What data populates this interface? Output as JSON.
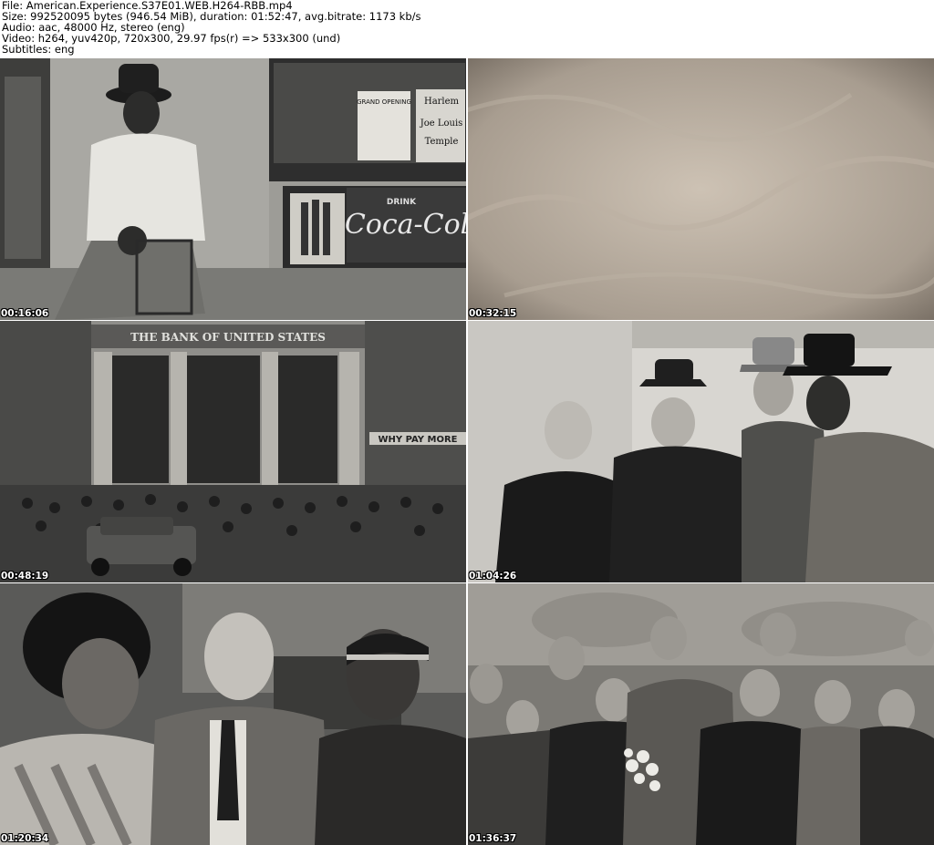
{
  "header": {
    "file_line": "File: American.Experience.S37E01.WEB.H264-RBB.mp4",
    "size_line": "Size: 992520095 bytes (946.54 MiB), duration: 01:52:47, avg.bitrate: 1173 kb/s",
    "audio_line": "Audio: aac, 48000 Hz, stereo (eng)",
    "video_line": "Video: h264, yuv420p, 720x300, 29.97 fps(r) => 533x300 (und)",
    "subs_line": "Subtitles: eng"
  },
  "thumbnails": [
    {
      "timestamp": "00:16:06",
      "signs": {
        "poster1": "GRAND OPENING",
        "poster2a": "Harlem",
        "poster2b": "Joe Louis",
        "poster2c": "Temple",
        "coke_small": "DRINK",
        "coke_big": "Coca-Cola"
      }
    },
    {
      "timestamp": "00:32:15"
    },
    {
      "timestamp": "00:48:19",
      "signs": {
        "bank": "THE BANK OF UNITED STATES",
        "store": "WHY PAY MORE"
      }
    },
    {
      "timestamp": "01:04:26"
    },
    {
      "timestamp": "01:20:34"
    },
    {
      "timestamp": "01:36:37"
    }
  ]
}
